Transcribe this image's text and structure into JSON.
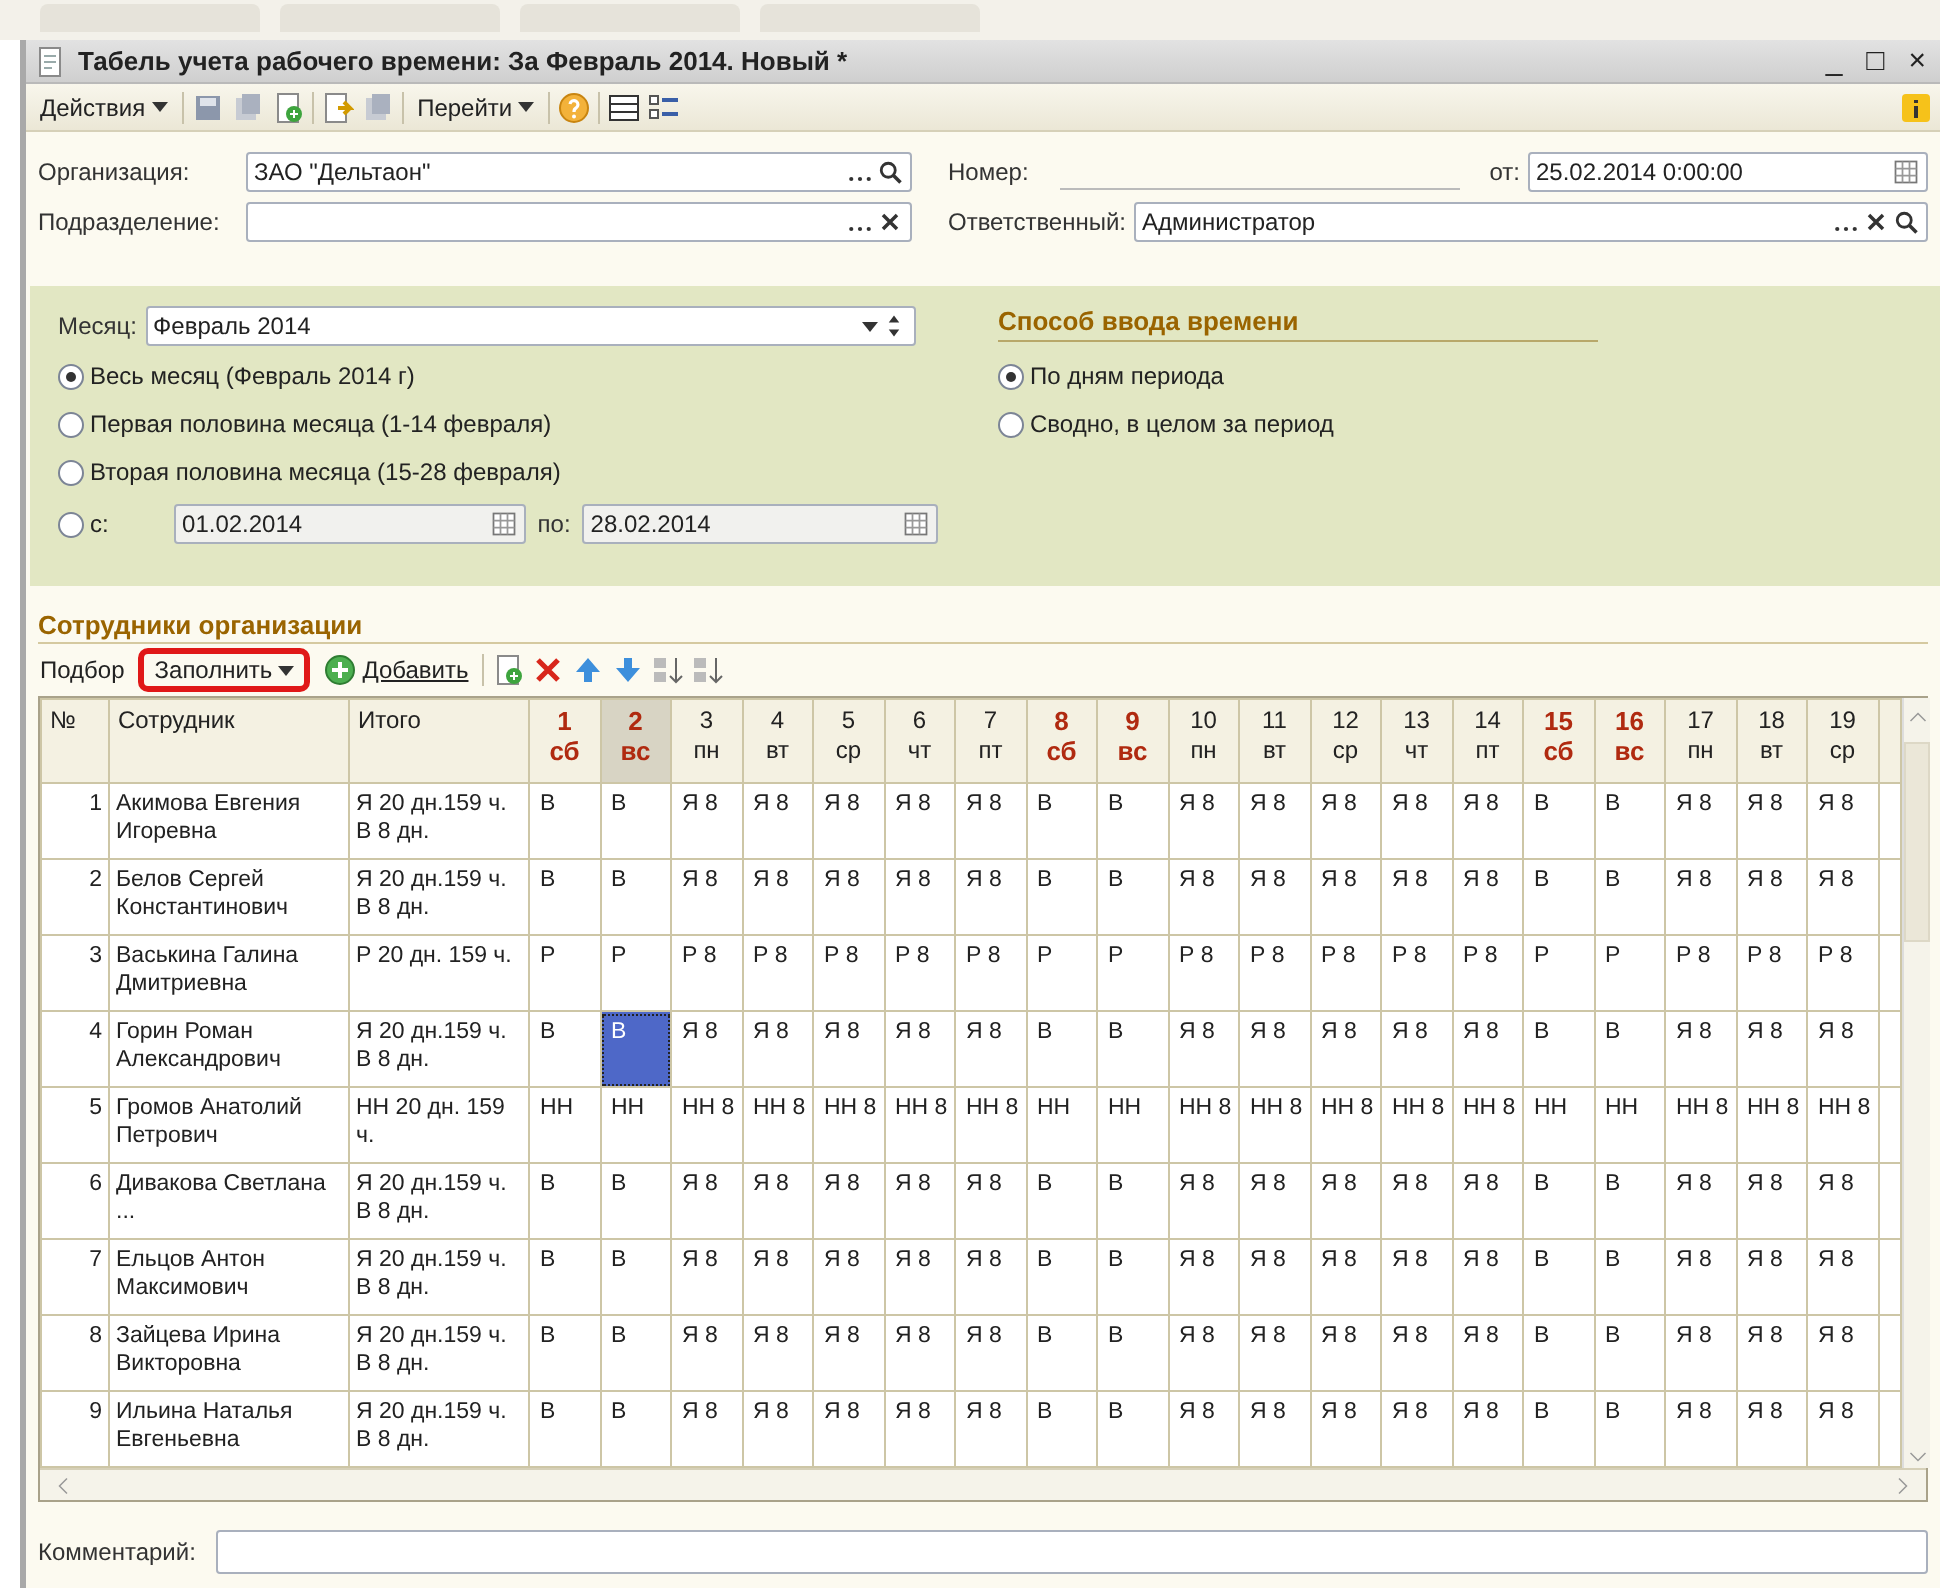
{
  "window": {
    "title": "Табель учета рабочего времени: За Февраль 2014. Новый *",
    "controls": [
      "_",
      "□",
      "×"
    ]
  },
  "toolbar": {
    "actions": "Действия",
    "goto": "Перейти"
  },
  "header_fields": {
    "organization": {
      "label": "Организация:",
      "value": "ЗАО \"Дельтаон\""
    },
    "number": {
      "label": "Номер:"
    },
    "date": {
      "label": "от:",
      "value": "25.02.2014  0:00:00"
    },
    "department": {
      "label": "Подразделение:"
    },
    "responsible": {
      "label": "Ответственный:",
      "value": "Администратор"
    }
  },
  "period": {
    "month_label": "Месяц:",
    "month": "Февраль 2014",
    "options": [
      {
        "kind": "plain",
        "label": "Весь месяц (Февраль 2014 г)",
        "selected": true
      },
      {
        "kind": "plain",
        "label": "Первая половина месяца (1-14 февраля)",
        "selected": false
      },
      {
        "kind": "plain",
        "label": "Вторая половина месяца (15-28 февраля)",
        "selected": false
      },
      {
        "kind": "range",
        "label": "с:",
        "from": "01.02.2014",
        "to_label": "по:",
        "to": "28.02.2014",
        "selected": false
      }
    ]
  },
  "entry_mode": {
    "title": "Способ ввода времени",
    "options": [
      {
        "label": "По дням периода",
        "selected": true
      },
      {
        "label": "Сводно, в целом за период",
        "selected": false
      }
    ]
  },
  "employees_section": {
    "title": "Сотрудники организации",
    "pick": "Подбор",
    "fill": {
      "label": "Заполнить",
      "highlighted": true
    },
    "add": "Добавить"
  },
  "table": {
    "columns": [
      "№",
      "Сотрудник",
      "Итого"
    ],
    "days": [
      {
        "day": "1",
        "weekday": "сб",
        "weekend": true,
        "selected": false
      },
      {
        "day": "2",
        "weekday": "вс",
        "weekend": true,
        "selected": true
      },
      {
        "day": "3",
        "weekday": "пн",
        "weekend": false,
        "selected": false
      },
      {
        "day": "4",
        "weekday": "вт",
        "weekend": false,
        "selected": false
      },
      {
        "day": "5",
        "weekday": "ср",
        "weekend": false,
        "selected": false
      },
      {
        "day": "6",
        "weekday": "чт",
        "weekend": false,
        "selected": false
      },
      {
        "day": "7",
        "weekday": "пт",
        "weekend": false,
        "selected": false
      },
      {
        "day": "8",
        "weekday": "сб",
        "weekend": true,
        "selected": false
      },
      {
        "day": "9",
        "weekday": "вс",
        "weekend": true,
        "selected": false
      },
      {
        "day": "10",
        "weekday": "пн",
        "weekend": false,
        "selected": false
      },
      {
        "day": "11",
        "weekday": "вт",
        "weekend": false,
        "selected": false
      },
      {
        "day": "12",
        "weekday": "ср",
        "weekend": false,
        "selected": false
      },
      {
        "day": "13",
        "weekday": "чт",
        "weekend": false,
        "selected": false
      },
      {
        "day": "14",
        "weekday": "пт",
        "weekend": false,
        "selected": false
      },
      {
        "day": "15",
        "weekday": "сб",
        "weekend": true,
        "selected": false
      },
      {
        "day": "16",
        "weekday": "вс",
        "weekend": true,
        "selected": false
      },
      {
        "day": "17",
        "weekday": "пн",
        "weekend": false,
        "selected": false
      },
      {
        "day": "18",
        "weekday": "вт",
        "weekend": false,
        "selected": false
      },
      {
        "day": "19",
        "weekday": "ср",
        "weekend": false,
        "selected": false
      }
    ],
    "rows": [
      {
        "num": "1",
        "employee": "Акимова Евгения Игоревна",
        "total": "Я 20 дн.159 ч. В 8 дн.",
        "days": [
          {
            "text": "В",
            "selected": false
          },
          {
            "text": "В",
            "selected": false
          },
          {
            "text": "Я 8",
            "selected": false
          },
          {
            "text": "Я 8",
            "selected": false
          },
          {
            "text": "Я 8",
            "selected": false
          },
          {
            "text": "Я 8",
            "selected": false
          },
          {
            "text": "Я 8",
            "selected": false
          },
          {
            "text": "В",
            "selected": false
          },
          {
            "text": "В",
            "selected": false
          },
          {
            "text": "Я 8",
            "selected": false
          },
          {
            "text": "Я 8",
            "selected": false
          },
          {
            "text": "Я 8",
            "selected": false
          },
          {
            "text": "Я 8",
            "selected": false
          },
          {
            "text": "Я 8",
            "selected": false
          },
          {
            "text": "В",
            "selected": false
          },
          {
            "text": "В",
            "selected": false
          },
          {
            "text": "Я 8",
            "selected": false
          },
          {
            "text": "Я 8",
            "selected": false
          },
          {
            "text": "Я 8",
            "selected": false
          }
        ]
      },
      {
        "num": "2",
        "employee": "Белов Сергей Константинович",
        "total": "Я 20 дн.159 ч. В 8 дн.",
        "days": [
          {
            "text": "В",
            "selected": false
          },
          {
            "text": "В",
            "selected": false
          },
          {
            "text": "Я 8",
            "selected": false
          },
          {
            "text": "Я 8",
            "selected": false
          },
          {
            "text": "Я 8",
            "selected": false
          },
          {
            "text": "Я 8",
            "selected": false
          },
          {
            "text": "Я 8",
            "selected": false
          },
          {
            "text": "В",
            "selected": false
          },
          {
            "text": "В",
            "selected": false
          },
          {
            "text": "Я 8",
            "selected": false
          },
          {
            "text": "Я 8",
            "selected": false
          },
          {
            "text": "Я 8",
            "selected": false
          },
          {
            "text": "Я 8",
            "selected": false
          },
          {
            "text": "Я 8",
            "selected": false
          },
          {
            "text": "В",
            "selected": false
          },
          {
            "text": "В",
            "selected": false
          },
          {
            "text": "Я 8",
            "selected": false
          },
          {
            "text": "Я 8",
            "selected": false
          },
          {
            "text": "Я 8",
            "selected": false
          }
        ]
      },
      {
        "num": "3",
        "employee": "Васькина Галина Дмитриевна",
        "total": "Р 20 дн. 159 ч.",
        "days": [
          {
            "text": "Р",
            "selected": false
          },
          {
            "text": "Р",
            "selected": false
          },
          {
            "text": "Р 8",
            "selected": false
          },
          {
            "text": "Р 8",
            "selected": false
          },
          {
            "text": "Р 8",
            "selected": false
          },
          {
            "text": "Р 8",
            "selected": false
          },
          {
            "text": "Р 8",
            "selected": false
          },
          {
            "text": "Р",
            "selected": false
          },
          {
            "text": "Р",
            "selected": false
          },
          {
            "text": "Р 8",
            "selected": false
          },
          {
            "text": "Р 8",
            "selected": false
          },
          {
            "text": "Р 8",
            "selected": false
          },
          {
            "text": "Р 8",
            "selected": false
          },
          {
            "text": "Р 8",
            "selected": false
          },
          {
            "text": "Р",
            "selected": false
          },
          {
            "text": "Р",
            "selected": false
          },
          {
            "text": "Р 8",
            "selected": false
          },
          {
            "text": "Р 8",
            "selected": false
          },
          {
            "text": "Р 8",
            "selected": false
          }
        ]
      },
      {
        "num": "4",
        "employee": "Горин Роман Александрович",
        "total": "Я 20 дн.159 ч. В 8 дн.",
        "days": [
          {
            "text": "В",
            "selected": false
          },
          {
            "text": "В",
            "selected": true
          },
          {
            "text": "Я 8",
            "selected": false
          },
          {
            "text": "Я 8",
            "selected": false
          },
          {
            "text": "Я 8",
            "selected": false
          },
          {
            "text": "Я 8",
            "selected": false
          },
          {
            "text": "Я 8",
            "selected": false
          },
          {
            "text": "В",
            "selected": false
          },
          {
            "text": "В",
            "selected": false
          },
          {
            "text": "Я 8",
            "selected": false
          },
          {
            "text": "Я 8",
            "selected": false
          },
          {
            "text": "Я 8",
            "selected": false
          },
          {
            "text": "Я 8",
            "selected": false
          },
          {
            "text": "Я 8",
            "selected": false
          },
          {
            "text": "В",
            "selected": false
          },
          {
            "text": "В",
            "selected": false
          },
          {
            "text": "Я 8",
            "selected": false
          },
          {
            "text": "Я 8",
            "selected": false
          },
          {
            "text": "Я 8",
            "selected": false
          }
        ]
      },
      {
        "num": "5",
        "employee": "Громов Анатолий Петрович",
        "total": "НН 20 дн. 159 ч.",
        "days": [
          {
            "text": "НН",
            "selected": false
          },
          {
            "text": "НН",
            "selected": false
          },
          {
            "text": "НН 8",
            "selected": false
          },
          {
            "text": "НН 8",
            "selected": false
          },
          {
            "text": "НН 8",
            "selected": false
          },
          {
            "text": "НН 8",
            "selected": false
          },
          {
            "text": "НН 8",
            "selected": false
          },
          {
            "text": "НН",
            "selected": false
          },
          {
            "text": "НН",
            "selected": false
          },
          {
            "text": "НН 8",
            "selected": false
          },
          {
            "text": "НН 8",
            "selected": false
          },
          {
            "text": "НН 8",
            "selected": false
          },
          {
            "text": "НН 8",
            "selected": false
          },
          {
            "text": "НН 8",
            "selected": false
          },
          {
            "text": "НН",
            "selected": false
          },
          {
            "text": "НН",
            "selected": false
          },
          {
            "text": "НН 8",
            "selected": false
          },
          {
            "text": "НН 8",
            "selected": false
          },
          {
            "text": "НН 8",
            "selected": false
          }
        ]
      },
      {
        "num": "6",
        "employee": "Дивакова Светлана ...",
        "total": "Я 20 дн.159 ч. В 8 дн.",
        "days": [
          {
            "text": "В",
            "selected": false
          },
          {
            "text": "В",
            "selected": false
          },
          {
            "text": "Я 8",
            "selected": false
          },
          {
            "text": "Я 8",
            "selected": false
          },
          {
            "text": "Я 8",
            "selected": false
          },
          {
            "text": "Я 8",
            "selected": false
          },
          {
            "text": "Я 8",
            "selected": false
          },
          {
            "text": "В",
            "selected": false
          },
          {
            "text": "В",
            "selected": false
          },
          {
            "text": "Я 8",
            "selected": false
          },
          {
            "text": "Я 8",
            "selected": false
          },
          {
            "text": "Я 8",
            "selected": false
          },
          {
            "text": "Я 8",
            "selected": false
          },
          {
            "text": "Я 8",
            "selected": false
          },
          {
            "text": "В",
            "selected": false
          },
          {
            "text": "В",
            "selected": false
          },
          {
            "text": "Я 8",
            "selected": false
          },
          {
            "text": "Я 8",
            "selected": false
          },
          {
            "text": "Я 8",
            "selected": false
          }
        ]
      },
      {
        "num": "7",
        "employee": "Ельцов Антон Максимович",
        "total": "Я 20 дн.159 ч. В 8 дн.",
        "days": [
          {
            "text": "В",
            "selected": false
          },
          {
            "text": "В",
            "selected": false
          },
          {
            "text": "Я 8",
            "selected": false
          },
          {
            "text": "Я 8",
            "selected": false
          },
          {
            "text": "Я 8",
            "selected": false
          },
          {
            "text": "Я 8",
            "selected": false
          },
          {
            "text": "Я 8",
            "selected": false
          },
          {
            "text": "В",
            "selected": false
          },
          {
            "text": "В",
            "selected": false
          },
          {
            "text": "Я 8",
            "selected": false
          },
          {
            "text": "Я 8",
            "selected": false
          },
          {
            "text": "Я 8",
            "selected": false
          },
          {
            "text": "Я 8",
            "selected": false
          },
          {
            "text": "Я 8",
            "selected": false
          },
          {
            "text": "В",
            "selected": false
          },
          {
            "text": "В",
            "selected": false
          },
          {
            "text": "Я 8",
            "selected": false
          },
          {
            "text": "Я 8",
            "selected": false
          },
          {
            "text": "Я 8",
            "selected": false
          }
        ]
      },
      {
        "num": "8",
        "employee": "Зайцева Ирина Викторовна",
        "total": "Я 20 дн.159 ч. В 8 дн.",
        "days": [
          {
            "text": "В",
            "selected": false
          },
          {
            "text": "В",
            "selected": false
          },
          {
            "text": "Я 8",
            "selected": false
          },
          {
            "text": "Я 8",
            "selected": false
          },
          {
            "text": "Я 8",
            "selected": false
          },
          {
            "text": "Я 8",
            "selected": false
          },
          {
            "text": "Я 8",
            "selected": false
          },
          {
            "text": "В",
            "selected": false
          },
          {
            "text": "В",
            "selected": false
          },
          {
            "text": "Я 8",
            "selected": false
          },
          {
            "text": "Я 8",
            "selected": false
          },
          {
            "text": "Я 8",
            "selected": false
          },
          {
            "text": "Я 8",
            "selected": false
          },
          {
            "text": "Я 8",
            "selected": false
          },
          {
            "text": "В",
            "selected": false
          },
          {
            "text": "В",
            "selected": false
          },
          {
            "text": "Я 8",
            "selected": false
          },
          {
            "text": "Я 8",
            "selected": false
          },
          {
            "text": "Я 8",
            "selected": false
          }
        ]
      },
      {
        "num": "9",
        "employee": "Ильина Наталья Евгеньевна",
        "total": "Я 20 дн.159 ч. В 8 дн.",
        "days": [
          {
            "text": "В",
            "selected": false
          },
          {
            "text": "В",
            "selected": false
          },
          {
            "text": "Я 8",
            "selected": false
          },
          {
            "text": "Я 8",
            "selected": false
          },
          {
            "text": "Я 8",
            "selected": false
          },
          {
            "text": "Я 8",
            "selected": false
          },
          {
            "text": "Я 8",
            "selected": false
          },
          {
            "text": "В",
            "selected": false
          },
          {
            "text": "В",
            "selected": false
          },
          {
            "text": "Я 8",
            "selected": false
          },
          {
            "text": "Я 8",
            "selected": false
          },
          {
            "text": "Я 8",
            "selected": false
          },
          {
            "text": "Я 8",
            "selected": false
          },
          {
            "text": "Я 8",
            "selected": false
          },
          {
            "text": "В",
            "selected": false
          },
          {
            "text": "В",
            "selected": false
          },
          {
            "text": "Я 8",
            "selected": false
          },
          {
            "text": "Я 8",
            "selected": false
          },
          {
            "text": "Я 8",
            "selected": false
          }
        ]
      }
    ]
  },
  "comment": {
    "label": "Комментарий:"
  }
}
